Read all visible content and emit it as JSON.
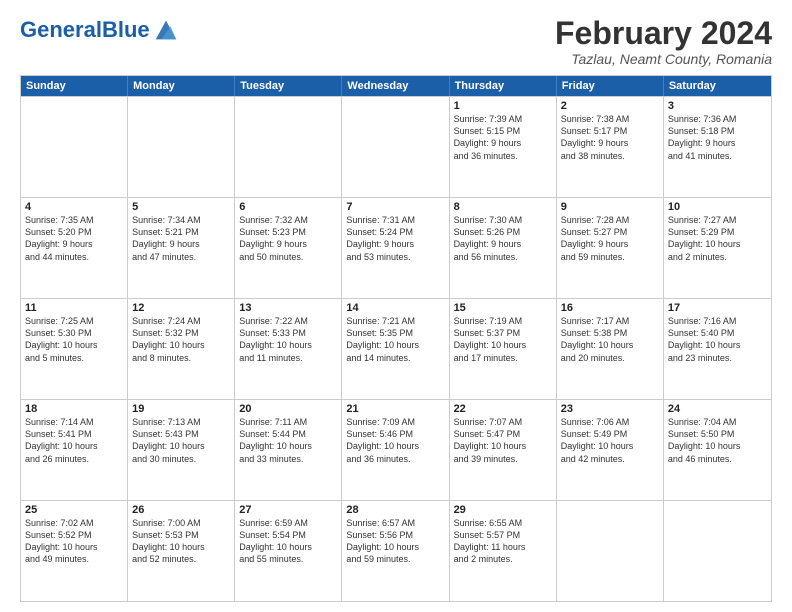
{
  "header": {
    "logo_text_general": "General",
    "logo_text_blue": "Blue",
    "month_title": "February 2024",
    "location": "Tazlau, Neamt County, Romania"
  },
  "weekdays": [
    "Sunday",
    "Monday",
    "Tuesday",
    "Wednesday",
    "Thursday",
    "Friday",
    "Saturday"
  ],
  "rows": [
    [
      {
        "day": "",
        "info": ""
      },
      {
        "day": "",
        "info": ""
      },
      {
        "day": "",
        "info": ""
      },
      {
        "day": "",
        "info": ""
      },
      {
        "day": "1",
        "info": "Sunrise: 7:39 AM\nSunset: 5:15 PM\nDaylight: 9 hours\nand 36 minutes."
      },
      {
        "day": "2",
        "info": "Sunrise: 7:38 AM\nSunset: 5:17 PM\nDaylight: 9 hours\nand 38 minutes."
      },
      {
        "day": "3",
        "info": "Sunrise: 7:36 AM\nSunset: 5:18 PM\nDaylight: 9 hours\nand 41 minutes."
      }
    ],
    [
      {
        "day": "4",
        "info": "Sunrise: 7:35 AM\nSunset: 5:20 PM\nDaylight: 9 hours\nand 44 minutes."
      },
      {
        "day": "5",
        "info": "Sunrise: 7:34 AM\nSunset: 5:21 PM\nDaylight: 9 hours\nand 47 minutes."
      },
      {
        "day": "6",
        "info": "Sunrise: 7:32 AM\nSunset: 5:23 PM\nDaylight: 9 hours\nand 50 minutes."
      },
      {
        "day": "7",
        "info": "Sunrise: 7:31 AM\nSunset: 5:24 PM\nDaylight: 9 hours\nand 53 minutes."
      },
      {
        "day": "8",
        "info": "Sunrise: 7:30 AM\nSunset: 5:26 PM\nDaylight: 9 hours\nand 56 minutes."
      },
      {
        "day": "9",
        "info": "Sunrise: 7:28 AM\nSunset: 5:27 PM\nDaylight: 9 hours\nand 59 minutes."
      },
      {
        "day": "10",
        "info": "Sunrise: 7:27 AM\nSunset: 5:29 PM\nDaylight: 10 hours\nand 2 minutes."
      }
    ],
    [
      {
        "day": "11",
        "info": "Sunrise: 7:25 AM\nSunset: 5:30 PM\nDaylight: 10 hours\nand 5 minutes."
      },
      {
        "day": "12",
        "info": "Sunrise: 7:24 AM\nSunset: 5:32 PM\nDaylight: 10 hours\nand 8 minutes."
      },
      {
        "day": "13",
        "info": "Sunrise: 7:22 AM\nSunset: 5:33 PM\nDaylight: 10 hours\nand 11 minutes."
      },
      {
        "day": "14",
        "info": "Sunrise: 7:21 AM\nSunset: 5:35 PM\nDaylight: 10 hours\nand 14 minutes."
      },
      {
        "day": "15",
        "info": "Sunrise: 7:19 AM\nSunset: 5:37 PM\nDaylight: 10 hours\nand 17 minutes."
      },
      {
        "day": "16",
        "info": "Sunrise: 7:17 AM\nSunset: 5:38 PM\nDaylight: 10 hours\nand 20 minutes."
      },
      {
        "day": "17",
        "info": "Sunrise: 7:16 AM\nSunset: 5:40 PM\nDaylight: 10 hours\nand 23 minutes."
      }
    ],
    [
      {
        "day": "18",
        "info": "Sunrise: 7:14 AM\nSunset: 5:41 PM\nDaylight: 10 hours\nand 26 minutes."
      },
      {
        "day": "19",
        "info": "Sunrise: 7:13 AM\nSunset: 5:43 PM\nDaylight: 10 hours\nand 30 minutes."
      },
      {
        "day": "20",
        "info": "Sunrise: 7:11 AM\nSunset: 5:44 PM\nDaylight: 10 hours\nand 33 minutes."
      },
      {
        "day": "21",
        "info": "Sunrise: 7:09 AM\nSunset: 5:46 PM\nDaylight: 10 hours\nand 36 minutes."
      },
      {
        "day": "22",
        "info": "Sunrise: 7:07 AM\nSunset: 5:47 PM\nDaylight: 10 hours\nand 39 minutes."
      },
      {
        "day": "23",
        "info": "Sunrise: 7:06 AM\nSunset: 5:49 PM\nDaylight: 10 hours\nand 42 minutes."
      },
      {
        "day": "24",
        "info": "Sunrise: 7:04 AM\nSunset: 5:50 PM\nDaylight: 10 hours\nand 46 minutes."
      }
    ],
    [
      {
        "day": "25",
        "info": "Sunrise: 7:02 AM\nSunset: 5:52 PM\nDaylight: 10 hours\nand 49 minutes."
      },
      {
        "day": "26",
        "info": "Sunrise: 7:00 AM\nSunset: 5:53 PM\nDaylight: 10 hours\nand 52 minutes."
      },
      {
        "day": "27",
        "info": "Sunrise: 6:59 AM\nSunset: 5:54 PM\nDaylight: 10 hours\nand 55 minutes."
      },
      {
        "day": "28",
        "info": "Sunrise: 6:57 AM\nSunset: 5:56 PM\nDaylight: 10 hours\nand 59 minutes."
      },
      {
        "day": "29",
        "info": "Sunrise: 6:55 AM\nSunset: 5:57 PM\nDaylight: 11 hours\nand 2 minutes."
      },
      {
        "day": "",
        "info": ""
      },
      {
        "day": "",
        "info": ""
      }
    ]
  ]
}
